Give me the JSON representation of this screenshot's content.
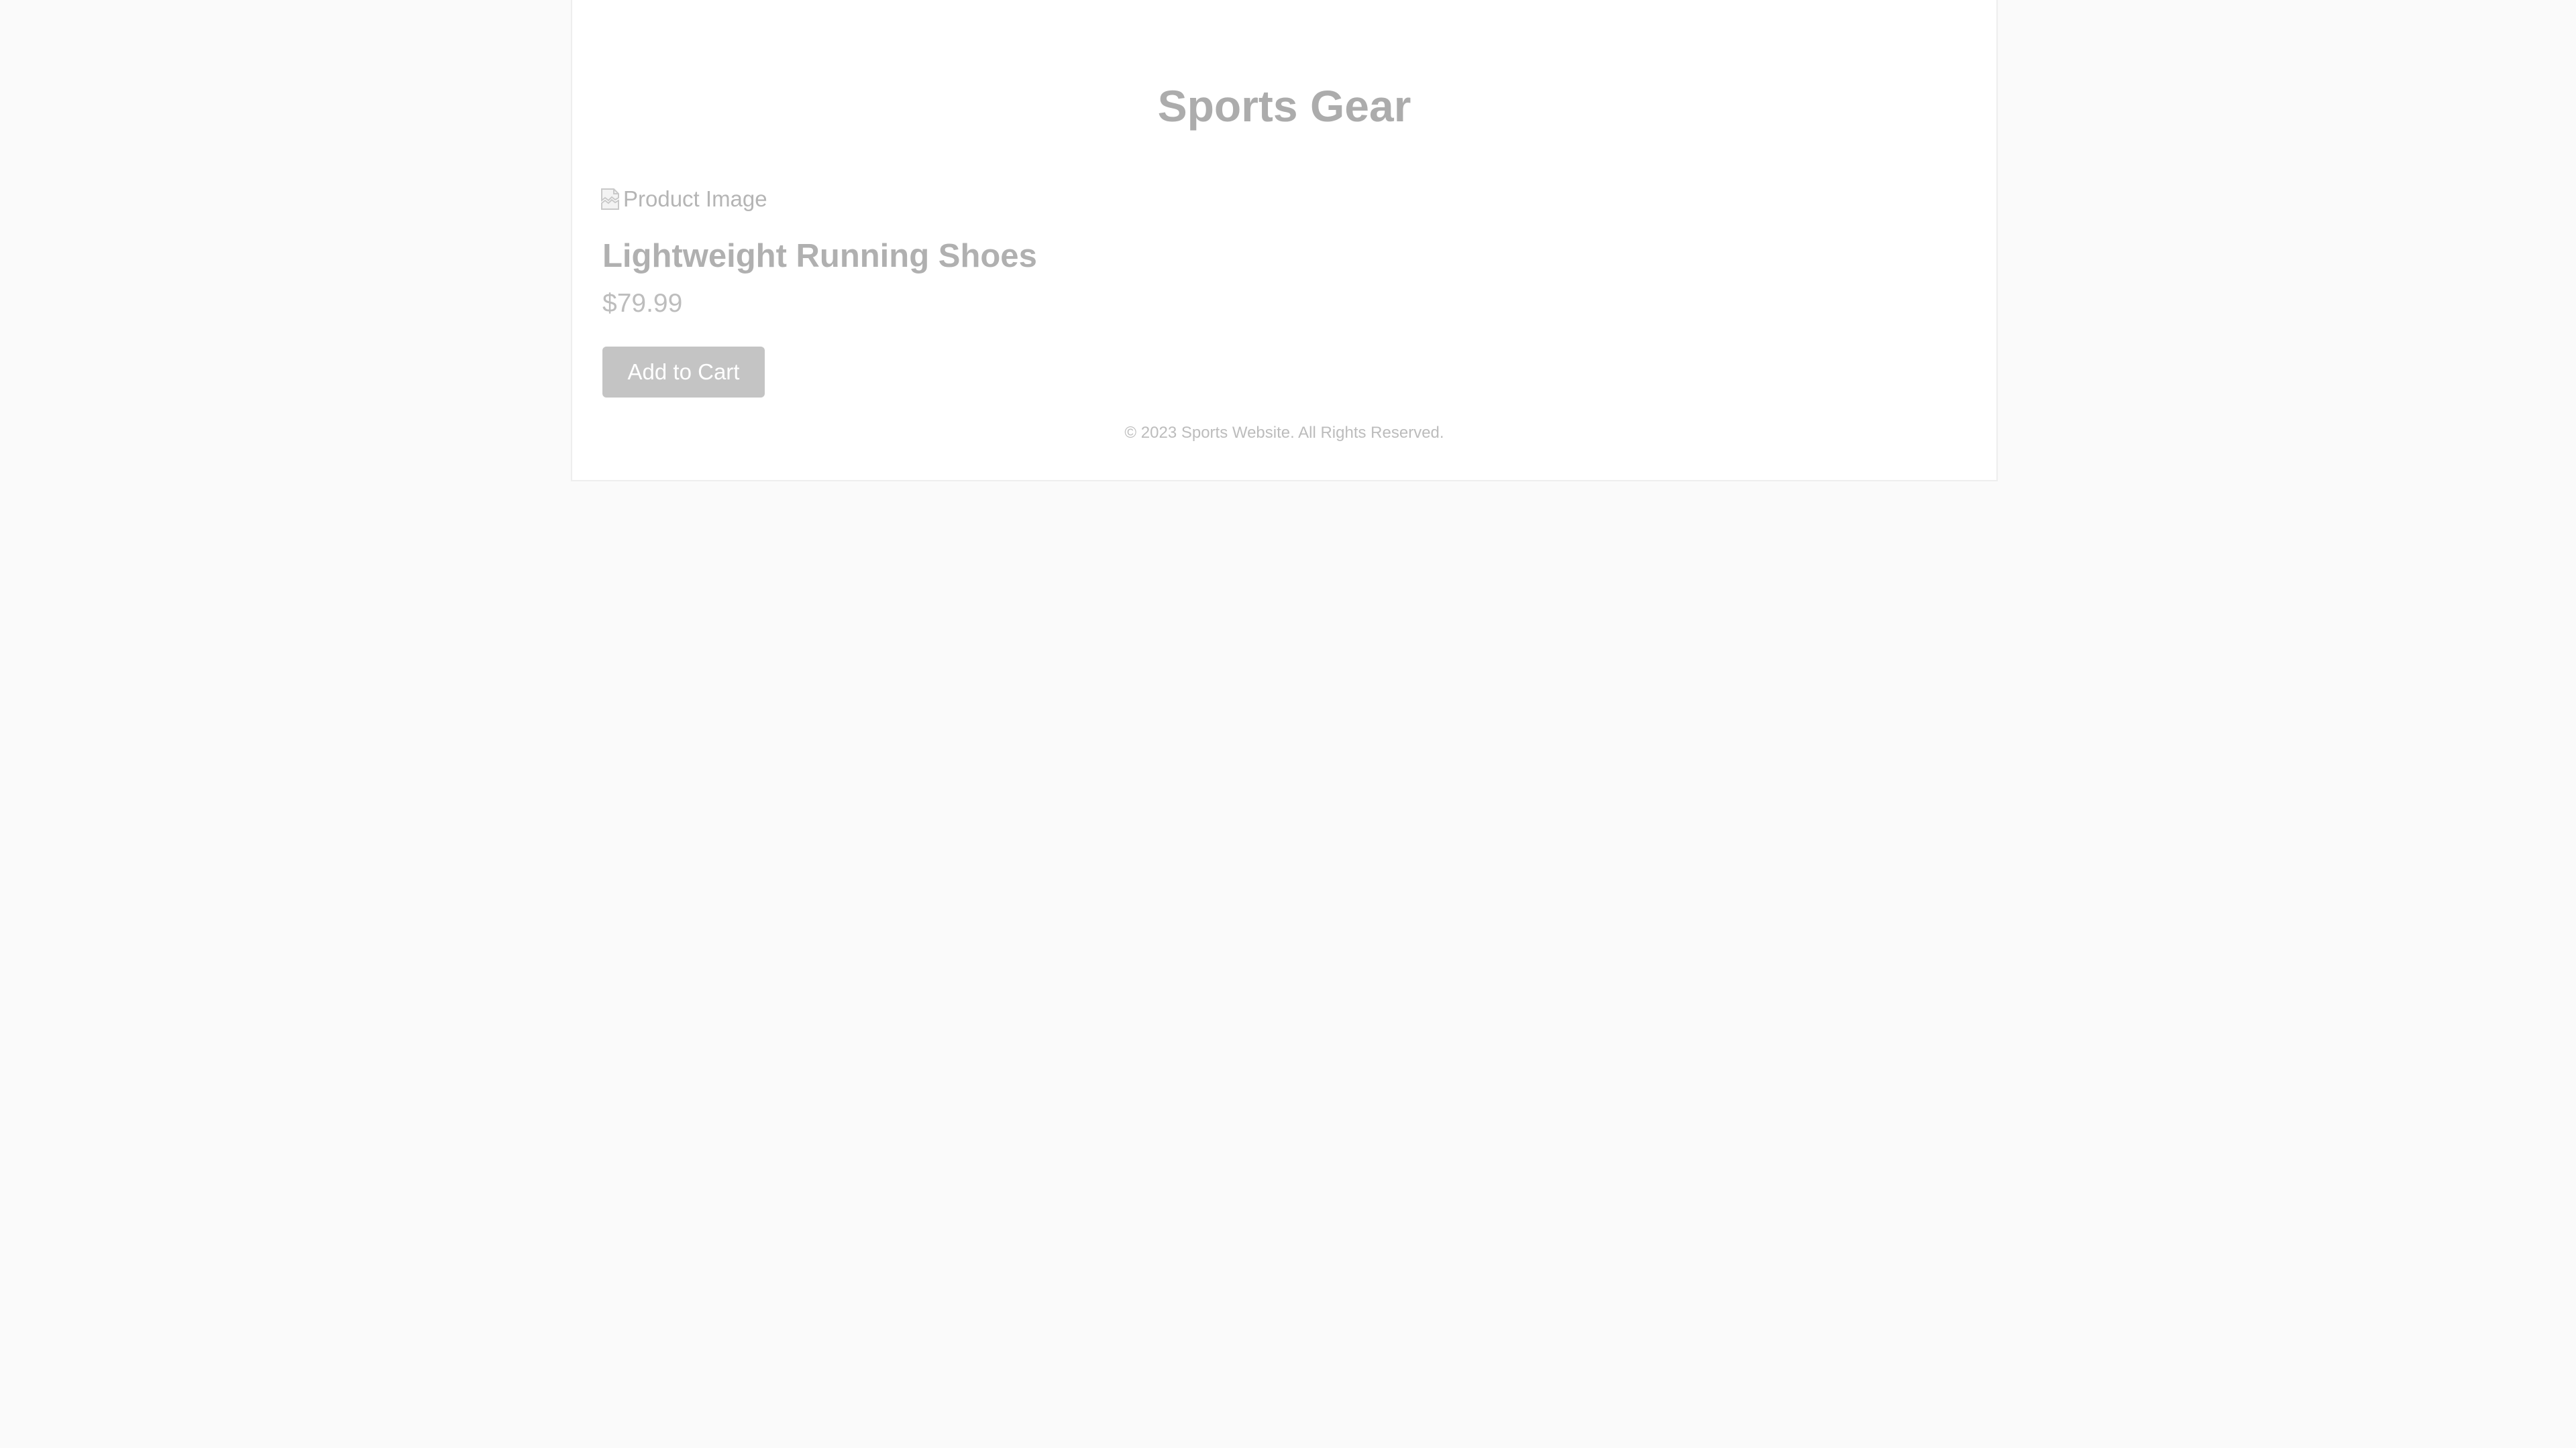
{
  "header": {
    "title": "Sports Gear"
  },
  "product": {
    "image_alt": "Product Image",
    "name": "Lightweight Running Shoes",
    "price": "$79.99",
    "add_to_cart_label": "Add to Cart"
  },
  "footer": {
    "copyright": "© 2023 Sports Website. All Rights Reserved."
  },
  "icons": {
    "broken_image": "broken-image-icon"
  },
  "colors": {
    "page_background": "#fafafa",
    "container_background": "#ffffff",
    "button_background": "#c4c4c4",
    "button_text": "#ffffff",
    "text": "#b3b3b3"
  }
}
